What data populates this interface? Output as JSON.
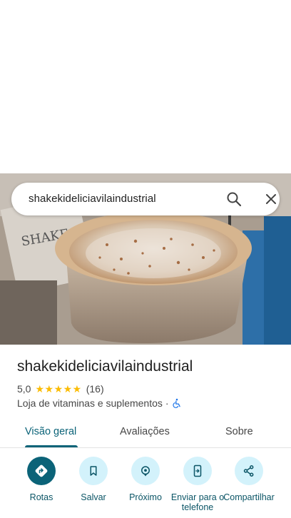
{
  "search": {
    "query": "shakekideliciavilaindustrial"
  },
  "place": {
    "name": "shakekideliciavilaindustrial",
    "rating": "5,0",
    "stars": "★★★★★",
    "review_count": "(16)",
    "category": "Loja de vitaminas e suplementos",
    "separator": "·"
  },
  "tabs": [
    {
      "label": "Visão geral",
      "active": true
    },
    {
      "label": "Avaliações",
      "active": false
    },
    {
      "label": "Sobre",
      "active": false
    }
  ],
  "actions": [
    {
      "label": "Rotas",
      "icon": "directions-icon"
    },
    {
      "label": "Salvar",
      "icon": "bookmark-icon"
    },
    {
      "label": "Próximo",
      "icon": "nearby-icon"
    },
    {
      "label": "Enviar para o telefone",
      "icon": "send-to-phone-icon"
    },
    {
      "label": "Compartilhar",
      "icon": "share-icon"
    }
  ],
  "colors": {
    "accent": "#0b6378",
    "chip_bg": "#d3f2fb",
    "star": "#fbbc04"
  }
}
